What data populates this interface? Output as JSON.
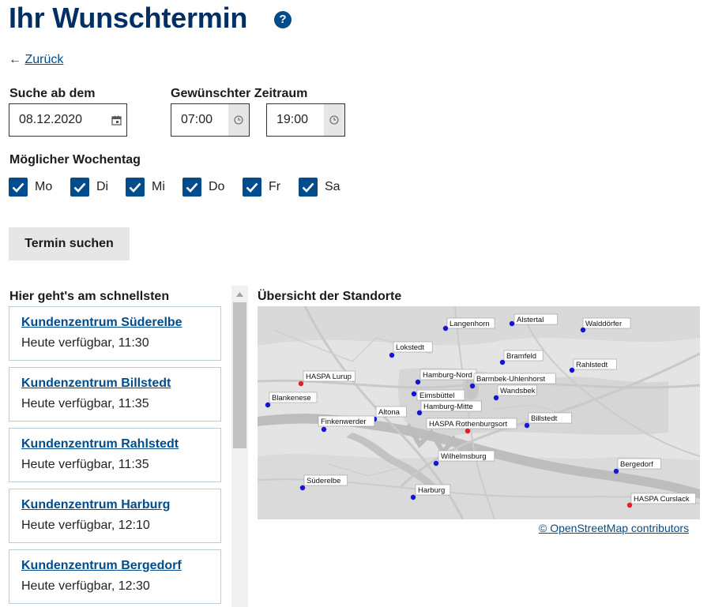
{
  "header": {
    "title": "Ihr Wunschtermin",
    "help_glyph": "?"
  },
  "nav": {
    "back_arrow": "←",
    "back_label": "Zurück"
  },
  "search": {
    "date_label": "Suche ab dem",
    "date_value": "08.12.2020",
    "time_label": "Gewünschter Zeitraum",
    "time_from": "07:00",
    "time_to": "19:00"
  },
  "weekdays": {
    "label": "Möglicher Wochentag",
    "items": [
      {
        "label": "Mo",
        "checked": true
      },
      {
        "label": "Di",
        "checked": true
      },
      {
        "label": "Mi",
        "checked": true
      },
      {
        "label": "Do",
        "checked": true
      },
      {
        "label": "Fr",
        "checked": true
      },
      {
        "label": "Sa",
        "checked": true
      }
    ]
  },
  "actions": {
    "search_button": "Termin suchen"
  },
  "results": {
    "heading": "Hier geht's am schnellsten",
    "items": [
      {
        "name": "Kundenzentrum Süderelbe",
        "availability": "Heute verfügbar, 11:30"
      },
      {
        "name": "Kundenzentrum Billstedt",
        "availability": "Heute verfügbar, 11:35"
      },
      {
        "name": "Kundenzentrum Rahlstedt",
        "availability": "Heute verfügbar, 11:35"
      },
      {
        "name": "Kundenzentrum Harburg",
        "availability": "Heute verfügbar, 12:10"
      },
      {
        "name": "Kundenzentrum Bergedorf",
        "availability": "Heute verfügbar, 12:30"
      }
    ]
  },
  "map": {
    "heading": "Übersicht der Standorte",
    "attribution": "© OpenStreetMap contributors",
    "marker_colors": {
      "standard": "#1414d2",
      "haspa": "#e02020"
    },
    "locations": [
      {
        "label": "Langenhorn",
        "type": "standard"
      },
      {
        "label": "Alstertal",
        "type": "standard"
      },
      {
        "label": "Walddörfer",
        "type": "standard"
      },
      {
        "label": "Lokstedt",
        "type": "standard"
      },
      {
        "label": "Bramfeld",
        "type": "standard"
      },
      {
        "label": "Rahlstedt",
        "type": "standard"
      },
      {
        "label": "HASPA Lurup",
        "type": "haspa"
      },
      {
        "label": "Hamburg-Nord",
        "type": "standard"
      },
      {
        "label": "Barmbek-Uhlenhorst",
        "type": "standard"
      },
      {
        "label": "Wandsbek",
        "type": "standard"
      },
      {
        "label": "Eimsbüttel",
        "type": "standard"
      },
      {
        "label": "Blankenese",
        "type": "standard"
      },
      {
        "label": "Hamburg-Mitte",
        "type": "standard"
      },
      {
        "label": "Altona",
        "type": "standard"
      },
      {
        "label": "Finkenwerder",
        "type": "standard"
      },
      {
        "label": "HASPA Rothenburgsort",
        "type": "haspa"
      },
      {
        "label": "Billstedt",
        "type": "standard"
      },
      {
        "label": "Wilhelmsburg",
        "type": "standard"
      },
      {
        "label": "Bergedorf",
        "type": "standard"
      },
      {
        "label": "Süderelbe",
        "type": "standard"
      },
      {
        "label": "Harburg",
        "type": "standard"
      },
      {
        "label": "HASPA Curslack",
        "type": "haspa"
      }
    ]
  }
}
